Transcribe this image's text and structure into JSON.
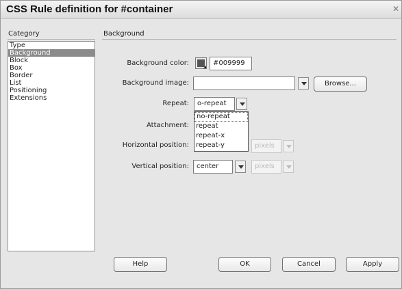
{
  "dialog": {
    "title": "CSS Rule definition for #container",
    "close_glyph": "✕"
  },
  "category": {
    "header": "Category",
    "items": [
      "Type",
      "Background",
      "Block",
      "Box",
      "Border",
      "List",
      "Positioning",
      "Extensions"
    ],
    "selected": "Background"
  },
  "section": {
    "header": "Background"
  },
  "fields": {
    "bg_color_label": "Background color:",
    "bg_color_value": "#009999",
    "bg_color_swatch": "#555555",
    "bg_image_label": "Background image:",
    "bg_image_value": "",
    "browse_label": "Browse...",
    "repeat_label": "Repeat:",
    "repeat_value": "o-repeat",
    "attachment_label": "Attachment:",
    "hpos_label": "Horizontal position:",
    "hpos_unit": "pixels",
    "vpos_label": "Vertical position:",
    "vpos_value": "center",
    "vpos_unit": "pixels"
  },
  "repeat_options": [
    "no-repeat",
    "repeat",
    "repeat-x",
    "repeat-y"
  ],
  "buttons": {
    "help": "Help",
    "ok": "OK",
    "cancel": "Cancel",
    "apply": "Apply"
  }
}
